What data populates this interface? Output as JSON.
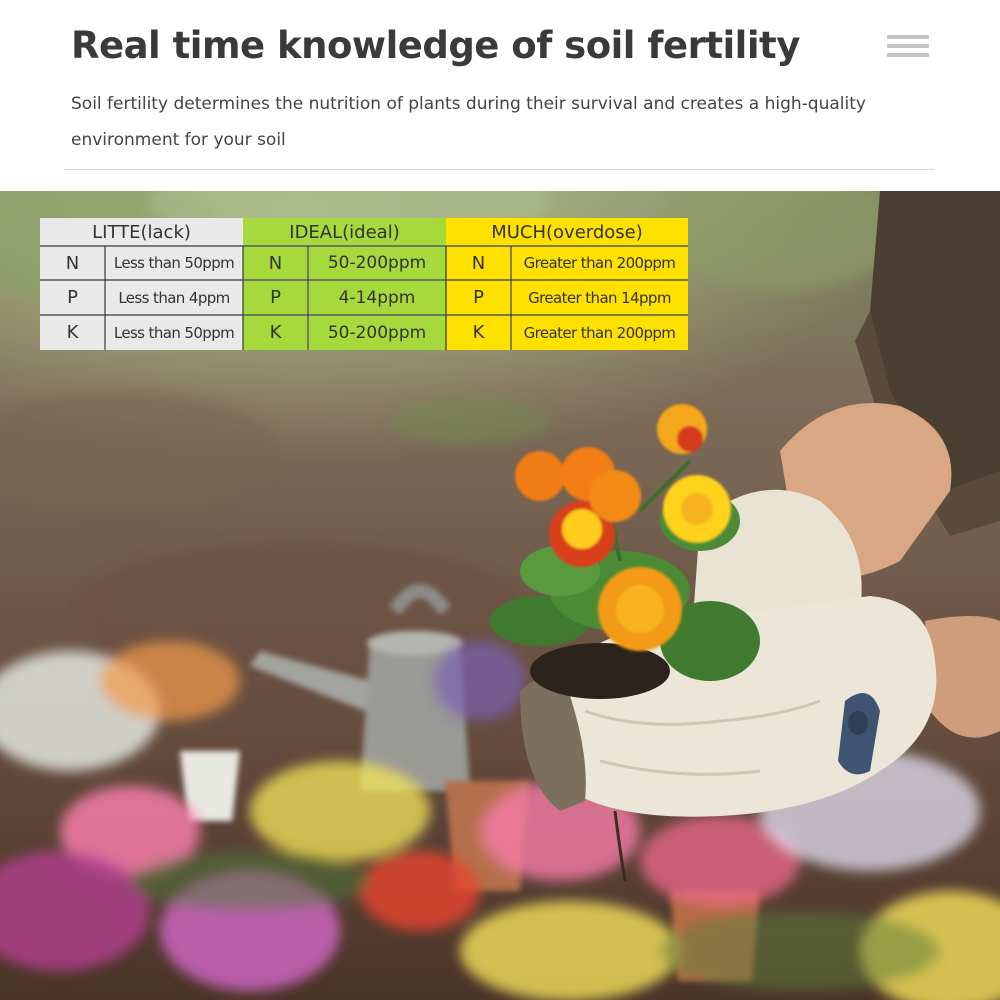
{
  "header": {
    "title": "Real time knowledge of soil fertility",
    "subtitle": "Soil fertility determines the nutrition of plants during their survival and creates a high-quality environment for your soil"
  },
  "menu_icon": "hamburger-menu-icon",
  "table": {
    "columns": [
      {
        "label": "LITTE(lack)",
        "color": "#e9e9e9"
      },
      {
        "label": "IDEAL(ideal)",
        "color": "#a6d93c"
      },
      {
        "label": "MUCH(overdose)",
        "color": "#ffe100"
      }
    ],
    "rows": [
      {
        "element": "N",
        "lack": "Less than 50ppm",
        "ideal": "50-200ppm",
        "overdose": "Greater than 200ppm"
      },
      {
        "element": "P",
        "lack": "Less than 4ppm",
        "ideal": "4-14ppm",
        "overdose": "Greater than 14ppm"
      },
      {
        "element": "K",
        "lack": "Less than 50ppm",
        "ideal": "50-200ppm",
        "overdose": "Greater than 200ppm"
      }
    ]
  },
  "photo": {
    "flower_colors": [
      "#f39a12",
      "#ffd21a",
      "#d8411c",
      "#ff7fb0",
      "#b33d8e",
      "#e8452e",
      "#f4f07a"
    ]
  }
}
